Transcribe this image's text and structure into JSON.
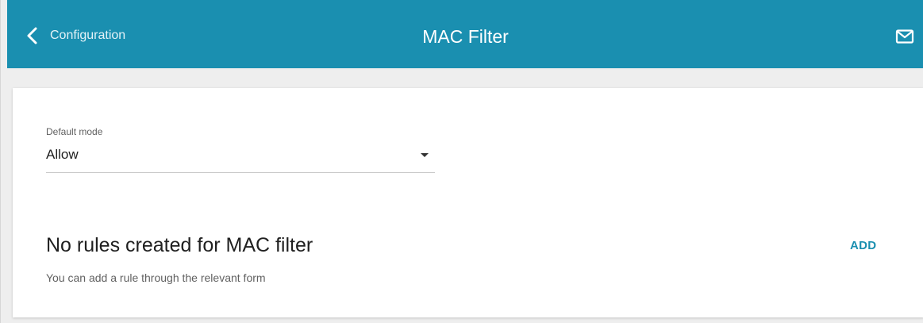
{
  "header": {
    "back_label": "Configuration",
    "title": "MAC Filter",
    "back_icon": "chevron-left-icon",
    "mail_icon": "mail-icon",
    "bg_color": "#1a8fb0"
  },
  "form": {
    "default_mode_label": "Default mode",
    "default_mode_value": "Allow"
  },
  "rules": {
    "empty_title": "No rules created for MAC filter",
    "empty_hint": "You can add a rule through the relevant form",
    "add_label": "ADD"
  }
}
